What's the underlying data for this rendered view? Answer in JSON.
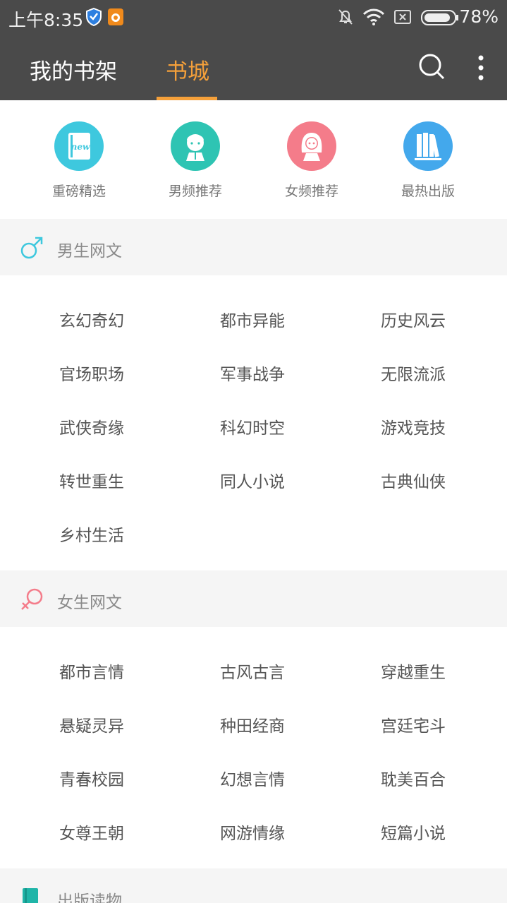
{
  "status_bar": {
    "time": "上午8:35",
    "battery": "78%",
    "icons": [
      "shield-icon",
      "squirrel-app-icon",
      "mute-bell-icon",
      "wifi-icon",
      "no-sim-icon",
      "battery-icon"
    ]
  },
  "header": {
    "tabs": [
      {
        "label": "我的书架"
      },
      {
        "label": "书城"
      }
    ],
    "active_tab": "书城",
    "icons": [
      "search-icon",
      "more-icon"
    ],
    "accent_color": "#f5a03a",
    "bar_color": "#4a4a4a"
  },
  "quick_links": [
    {
      "label": "重磅精选",
      "icon": "new-book-icon",
      "color": "#3ec8de"
    },
    {
      "label": "男频推荐",
      "icon": "boy-icon",
      "color": "#2ec4b3"
    },
    {
      "label": "女频推荐",
      "icon": "girl-icon",
      "color": "#f47c8a"
    },
    {
      "label": "最热出版",
      "icon": "books-icon",
      "color": "#43a8ec"
    }
  ],
  "sections": [
    {
      "title": "男生网文",
      "icon": "male-symbol-icon",
      "items": [
        "玄幻奇幻",
        "都市异能",
        "历史风云",
        "官场职场",
        "军事战争",
        "无限流派",
        "武侠奇缘",
        "科幻时空",
        "游戏竞技",
        "转世重生",
        "同人小说",
        "古典仙侠",
        "乡村生活"
      ]
    },
    {
      "title": "女生网文",
      "icon": "female-symbol-icon",
      "items": [
        "都市言情",
        "古风古言",
        "穿越重生",
        "悬疑灵异",
        "种田经商",
        "宫廷宅斗",
        "青春校园",
        "幻想言情",
        "耽美百合",
        "女尊王朝",
        "网游情缘",
        "短篇小说"
      ]
    },
    {
      "title": "出版读物",
      "icon": "book-icon",
      "items": []
    }
  ]
}
